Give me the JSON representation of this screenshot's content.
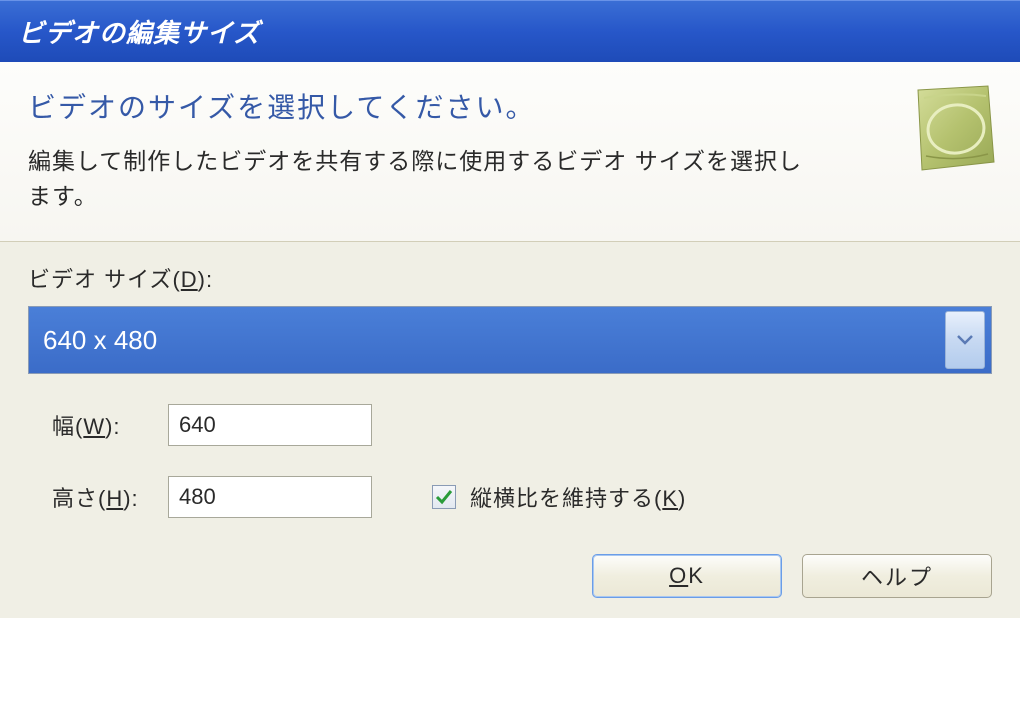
{
  "titlebar": {
    "title": "ビデオの編集サイズ"
  },
  "header": {
    "title": "ビデオのサイズを選択してください。",
    "description": "編集して制作したビデオを共有する際に使用するビデオ サイズを選択します。"
  },
  "form": {
    "size_label": "ビデオ サイズ(",
    "size_accel": "D",
    "size_label_end": "):",
    "size_value": "640 x 480",
    "width_label": "幅(",
    "width_accel": "W",
    "width_label_end": "):",
    "width_value": "640",
    "height_label": "高さ(",
    "height_accel": "H",
    "height_label_end": "):",
    "height_value": "480",
    "aspect_label": "縦横比を維持する(",
    "aspect_accel": "K",
    "aspect_label_end": ")",
    "aspect_checked": true
  },
  "buttons": {
    "ok_pre": "O",
    "ok_post": "K",
    "help": "ヘルプ"
  }
}
